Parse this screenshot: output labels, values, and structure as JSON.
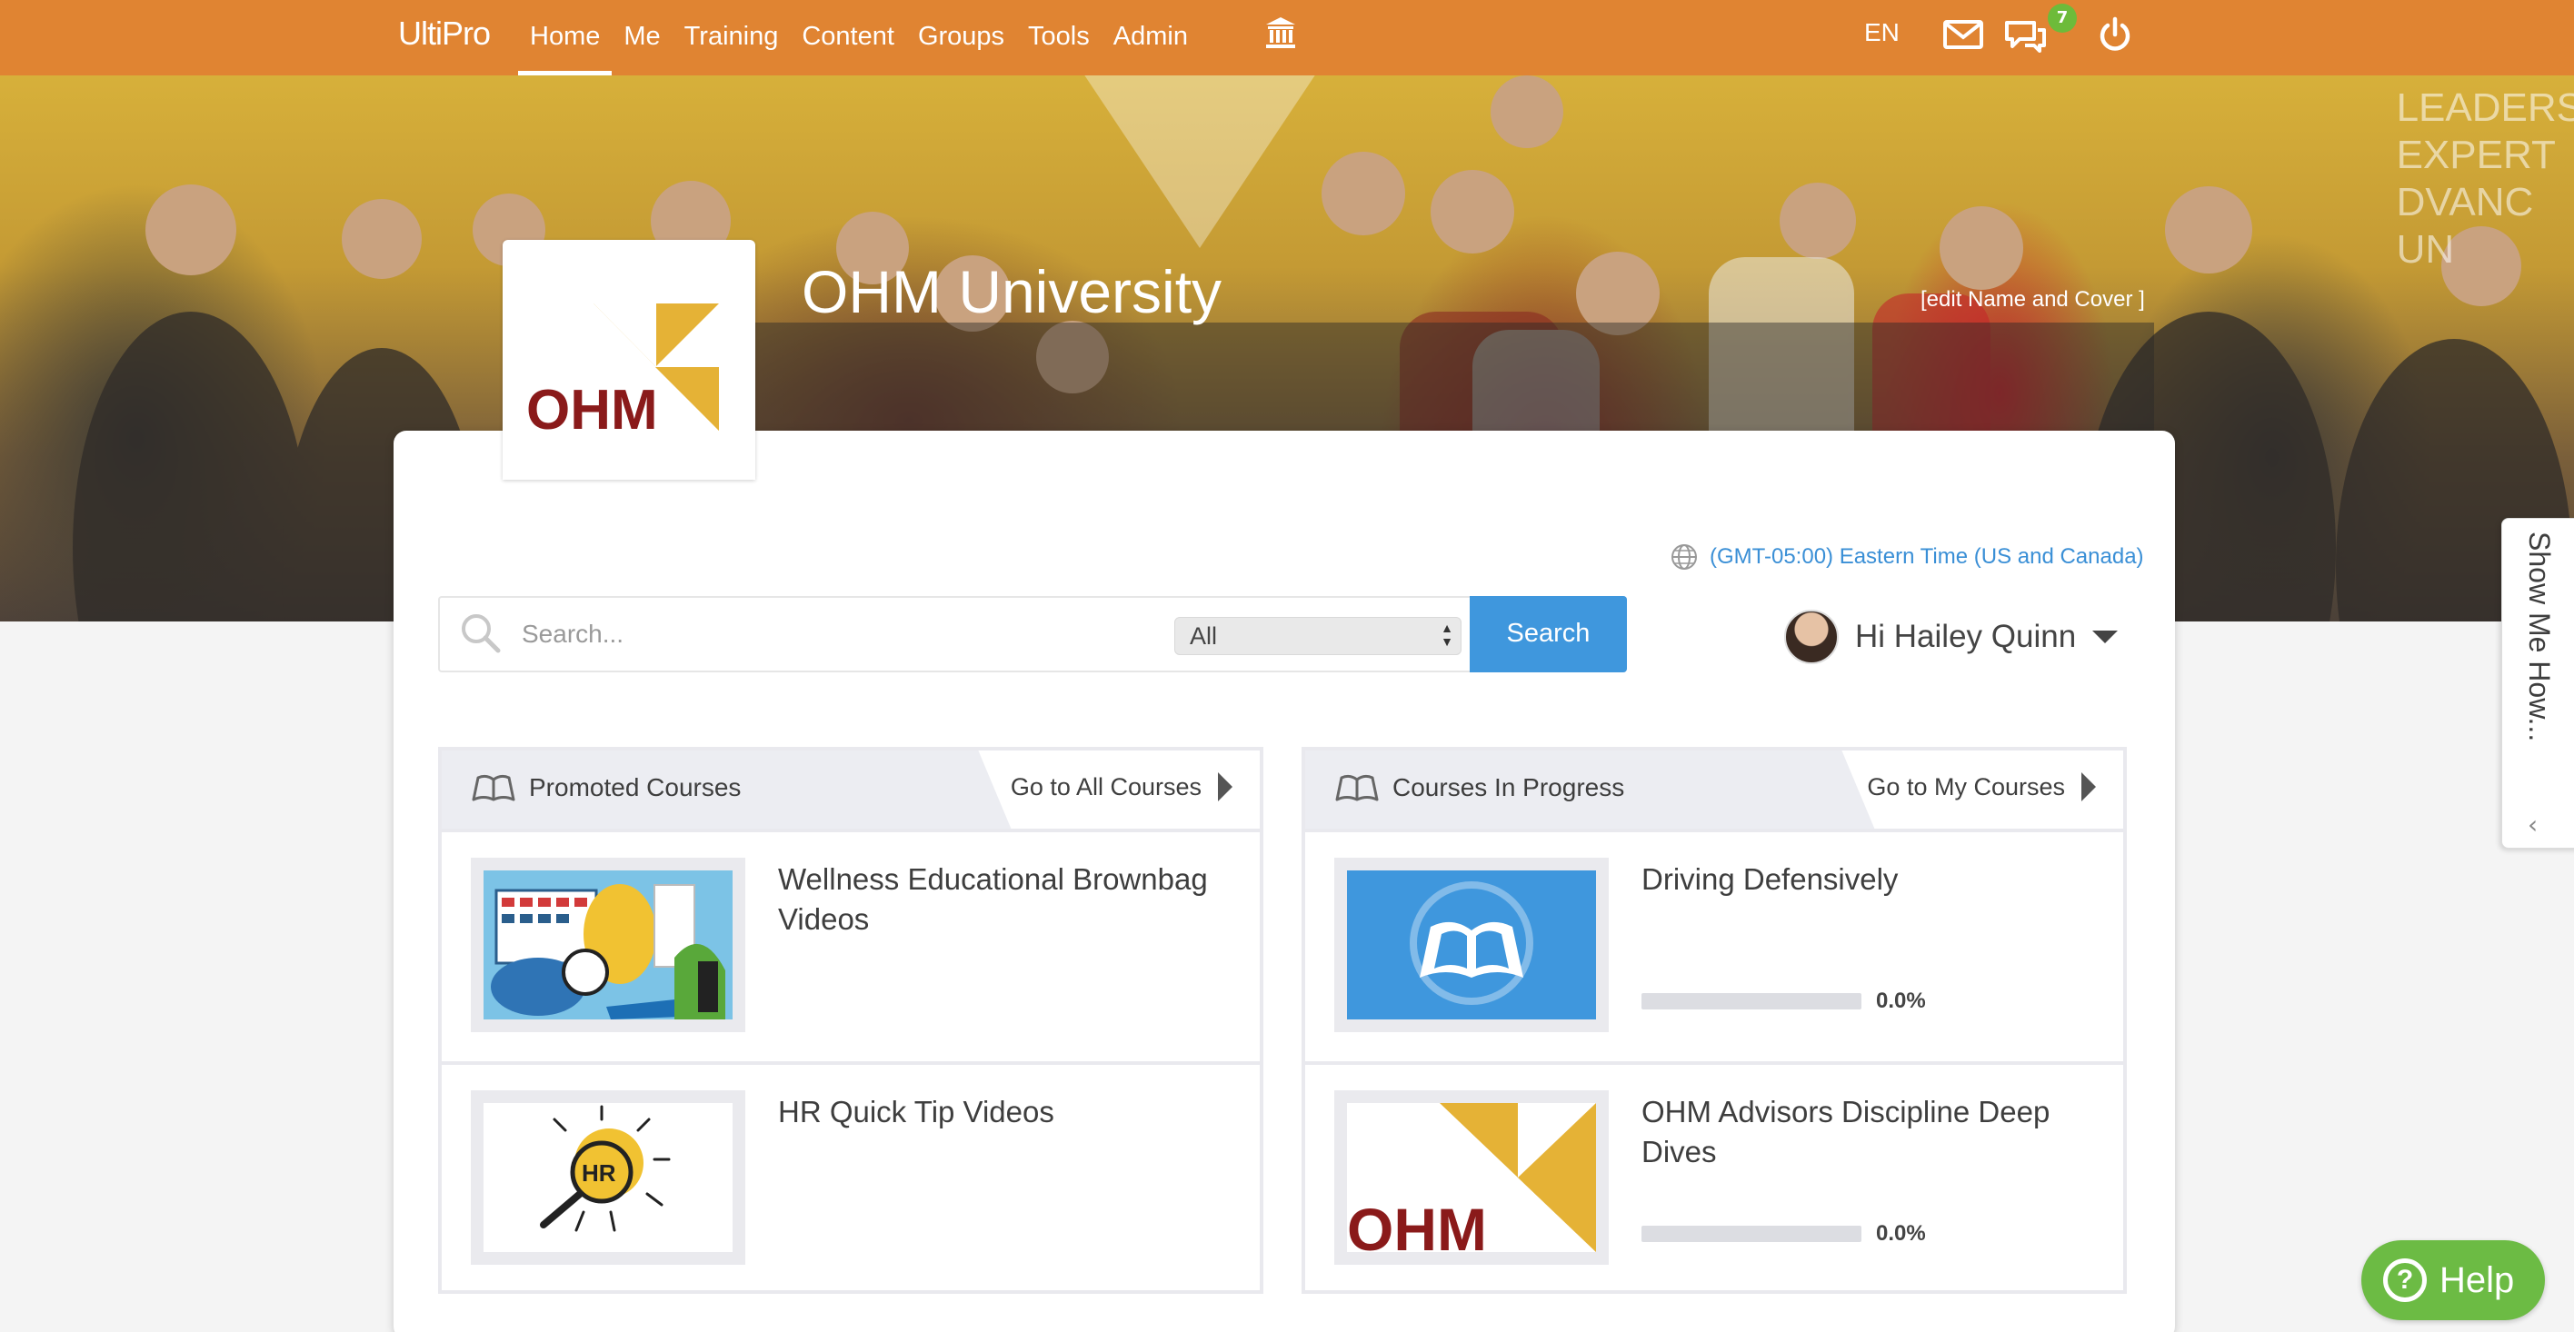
{
  "brand": "UltiPro",
  "nav": [
    {
      "label": "Home",
      "active": true
    },
    {
      "label": "Me"
    },
    {
      "label": "Training"
    },
    {
      "label": "Content"
    },
    {
      "label": "Groups"
    },
    {
      "label": "Tools"
    },
    {
      "label": "Admin"
    }
  ],
  "topbar": {
    "language": "EN",
    "notification_count": "7",
    "accent_color": "#e08432"
  },
  "hero": {
    "title": "OHM University",
    "edit_link": "[edit Name and Cover ]",
    "wall_text": [
      "LEADERS",
      "EXPERT",
      "DVANC",
      "UN"
    ],
    "logo_text": "OHM"
  },
  "timezone": "(GMT-05:00) Eastern Time (US and Canada)",
  "search": {
    "placeholder": "Search...",
    "filter_value": "All",
    "button_label": "Search"
  },
  "user": {
    "greeting": "Hi Hailey Quinn"
  },
  "promoted": {
    "title": "Promoted Courses",
    "link": "Go to All Courses",
    "items": [
      {
        "title": "Wellness Educational Brownbag Videos",
        "thumb": "wellness-illustration"
      },
      {
        "title": "HR Quick Tip Videos",
        "thumb": "hr-magnifier-illustration",
        "thumb_text": "HR"
      }
    ]
  },
  "in_progress": {
    "title": "Courses In Progress",
    "link": "Go to My Courses",
    "items": [
      {
        "title": "Driving Defensively",
        "thumb": "book-icon",
        "progress": 0.0,
        "progress_label": "0.0%"
      },
      {
        "title": "OHM Advisors Discipline Deep Dives",
        "thumb": "ohm-logo",
        "thumb_text": "OHM",
        "progress": 0.0,
        "progress_label": "0.0%"
      }
    ]
  },
  "show_me_how": "Show Me How...",
  "help": {
    "icon_glyph": "?",
    "label": "Help",
    "color": "#6cbb44"
  },
  "colors": {
    "primary_blue": "#3f97dd",
    "logo_red": "#8a1a1a",
    "logo_gold": "#e5b236"
  }
}
